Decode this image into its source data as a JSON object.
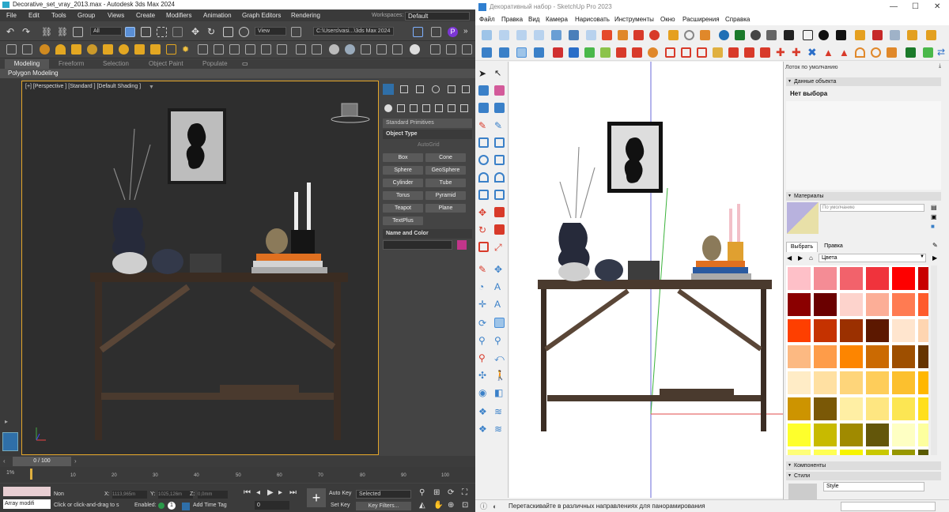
{
  "max": {
    "title": "Decorative_set_vray_2013.max - Autodesk 3ds Max 2024",
    "menu": [
      "File",
      "Edit",
      "Tools",
      "Group",
      "Views",
      "Create",
      "Modifiers",
      "Animation",
      "Graph Editors",
      "Rendering"
    ],
    "workspace_label": "Workspaces:",
    "workspace_value": "Default",
    "selection_filter": "All",
    "view_combo": "View",
    "path_combo": "C:\\Users\\vasi...\\3ds Max 2024",
    "ribbon_tabs": [
      "Modeling",
      "Freeform",
      "Selection",
      "Object Paint",
      "Populate"
    ],
    "poly_label": "Polygon Modeling",
    "viewport_label": "[+] [Perspective ] [Standard ] [Default Shading ]",
    "primitives_combo": "Standard Primitives",
    "object_type_title": "Object Type",
    "autogrid": "AutoGrid",
    "primitives": [
      "Box",
      "Cone",
      "Sphere",
      "GeoSphere",
      "Cylinder",
      "Tube",
      "Torus",
      "Pyramid",
      "Teapot",
      "Plane",
      "TextPlus"
    ],
    "name_color_title": "Name and Color",
    "name_color_swatch": "#c2358a",
    "time_slider": "0 / 100",
    "track_ticks": [
      "10",
      "20",
      "30",
      "40",
      "50",
      "60",
      "70",
      "80",
      "90",
      "100"
    ],
    "track_percent": "1%",
    "array_field": "Array modifi",
    "status_hint": "Click or click-and-drag to s",
    "none_label": "Non",
    "x_label": "X:",
    "x_value": "1113,965m",
    "y_label": "Y:",
    "y_value": "1025,126m",
    "z_label": "Z:",
    "z_value": "0,0mm",
    "enabled_label": "Enabled:",
    "add_time_tag": "Add Time Tag",
    "frame_value": "0",
    "auto_key": "Auto Key",
    "set_key": "Set Key",
    "key_mode": "Selected",
    "key_filters": "Key Filters..."
  },
  "su": {
    "title": "Декоративный набор - SketchUp Pro 2023",
    "menu": [
      "Файл",
      "Правка",
      "Вид",
      "Камера",
      "Нарисовать",
      "Инструменты",
      "Окно",
      "Расширения",
      "Справка"
    ],
    "tray_title": "Лоток по умолчанию",
    "entity_info": "Данные объекта",
    "no_selection": "Нет выбора",
    "materials": "Материалы",
    "material_default": "По умолчанию",
    "tab_select": "Выбрать",
    "tab_edit": "Правка",
    "library": "Цвета",
    "components": "Компоненты",
    "styles": "Стили",
    "style_name": "Style",
    "status": "Перетаскивайте в различных направлениях для панорамирования",
    "swatches": [
      "#fec0c8",
      "#f48c95",
      "#f2626b",
      "#f0333c",
      "#fe0000",
      "#c80000",
      "#8b0000",
      "#6a0000",
      "#fdd3cc",
      "#fcae97",
      "#ff7b52",
      "#fe5b2c",
      "#fe3f00",
      "#c53200",
      "#9b3000",
      "#5c1800",
      "#ffe5ce",
      "#fed5b1",
      "#fcb982",
      "#fe9c49",
      "#fd8500",
      "#cb6a02",
      "#9e4f00",
      "#663400",
      "#ffecc6",
      "#ffe0a2",
      "#fed57a",
      "#fecd5a",
      "#fcc02e",
      "#ffb700",
      "#cd9400",
      "#7a5806",
      "#ffefa4",
      "#fee681",
      "#fce653",
      "#ffdf1c",
      "#feff2c",
      "#c8ba00",
      "#a08a00",
      "#63560a",
      "#feffc3",
      "#fdff9e",
      "#fefe78",
      "#ffff53",
      "#f7f400",
      "#c9c800",
      "#979700",
      "#595a00"
    ]
  }
}
